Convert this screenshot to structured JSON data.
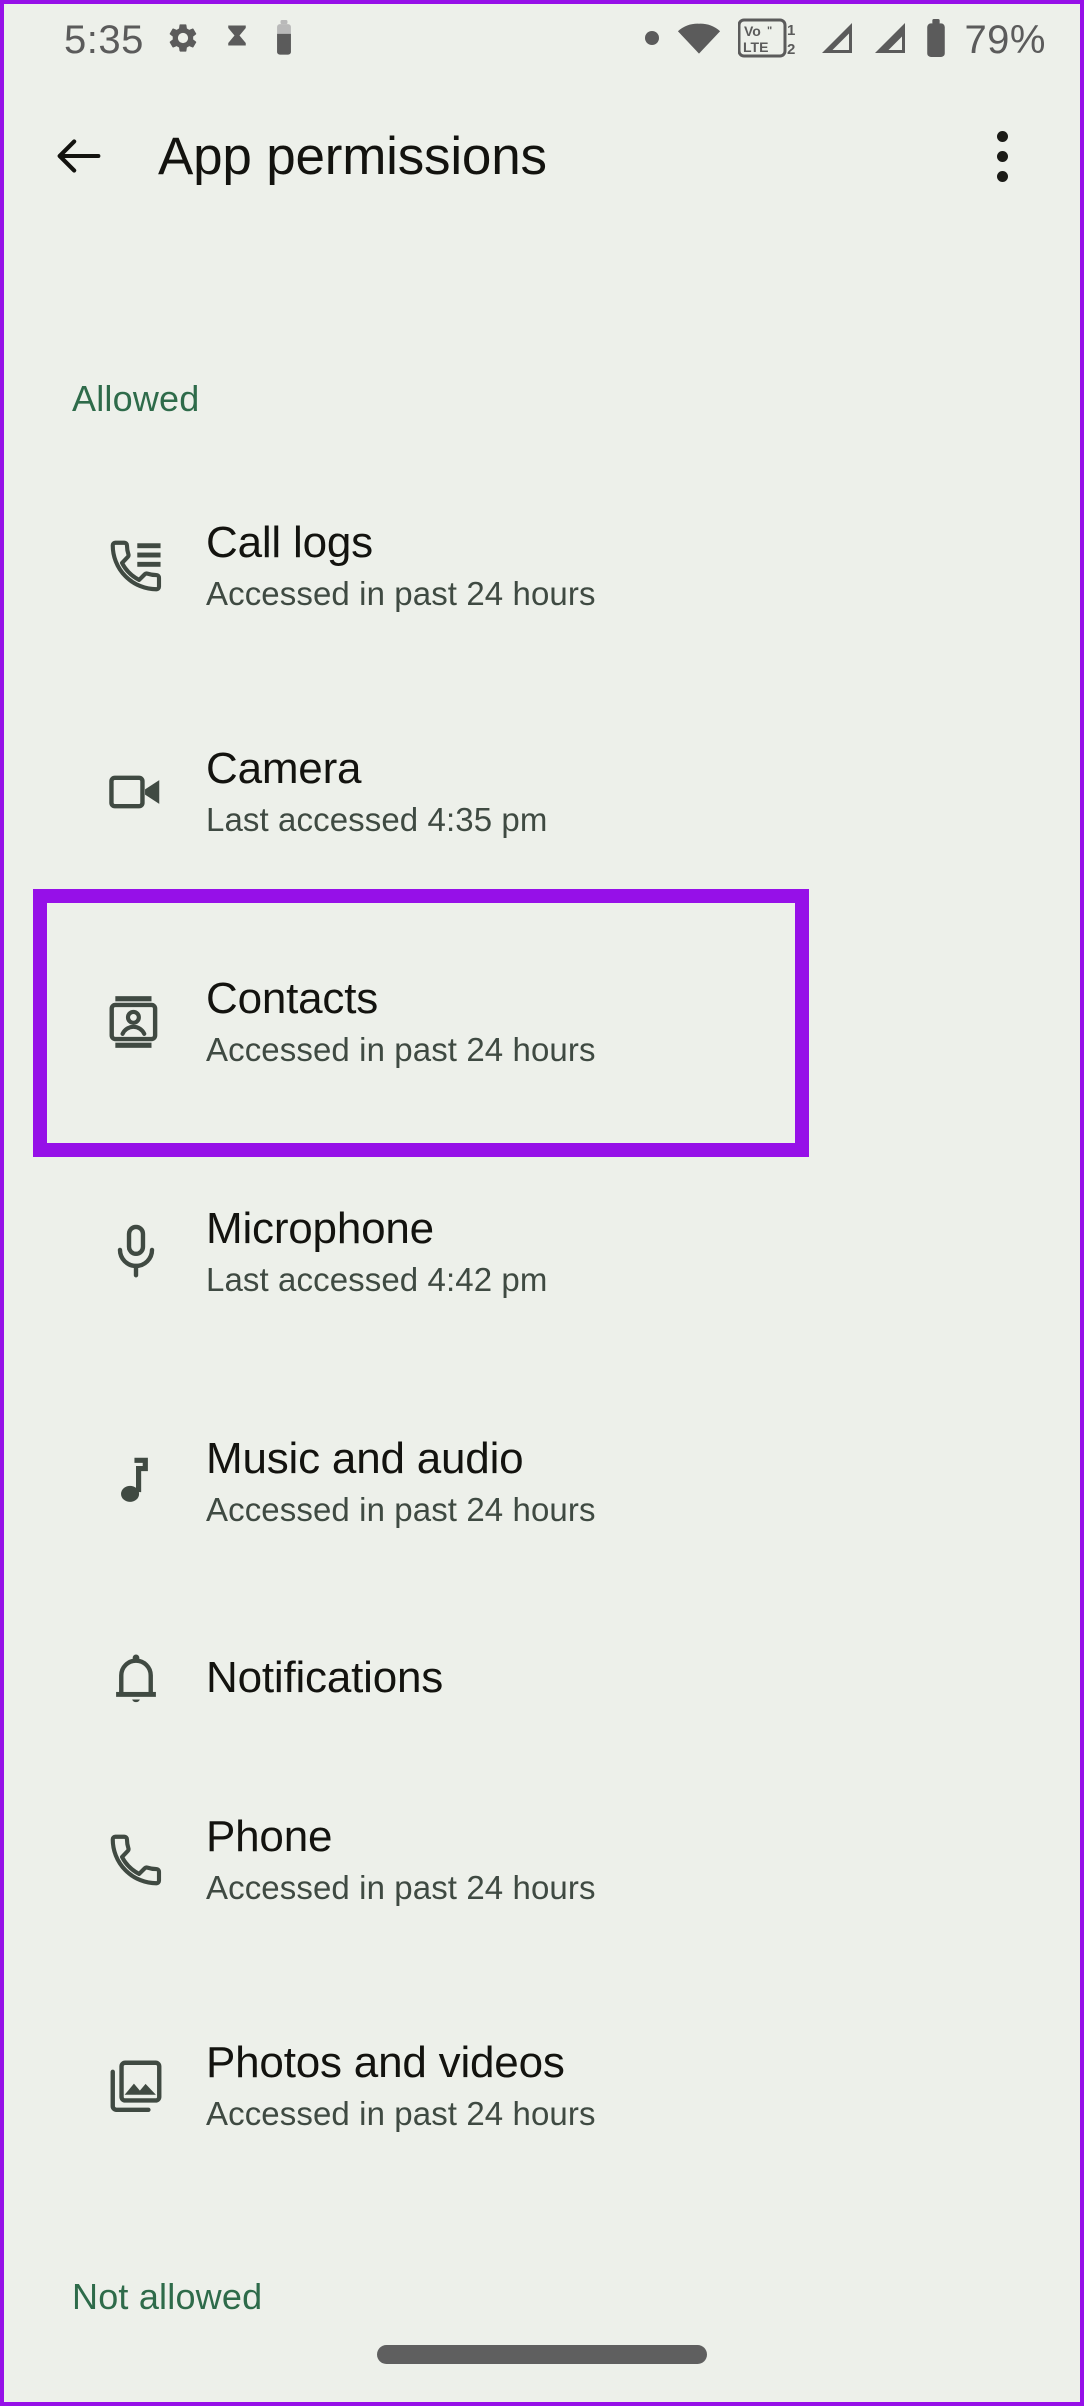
{
  "status_bar": {
    "time": "5:35",
    "battery_percent": "79%",
    "icons": [
      "gear-icon",
      "hourglass-icon",
      "battery-small-icon",
      "dot-icon",
      "wifi-icon",
      "volte-icon",
      "signal-1-icon",
      "signal-2-icon",
      "battery-icon"
    ],
    "volte_label_top": "Vo",
    "volte_label_bottom": "LTE",
    "sim1": "1",
    "sim2": "2"
  },
  "app_bar": {
    "back_label": "Back",
    "title": "App permissions",
    "overflow_label": "More options"
  },
  "sections": [
    {
      "label": "Allowed"
    },
    {
      "label": "Not allowed"
    }
  ],
  "permissions": [
    {
      "icon": "call-logs-icon",
      "title": "Call logs",
      "subtitle": "Accessed in past 24 hours"
    },
    {
      "icon": "camera-icon",
      "title": "Camera",
      "subtitle": "Last accessed 4:35 pm"
    },
    {
      "icon": "contacts-icon",
      "title": "Contacts",
      "subtitle": "Accessed in past 24 hours"
    },
    {
      "icon": "microphone-icon",
      "title": "Microphone",
      "subtitle": "Last accessed 4:42 pm"
    },
    {
      "icon": "music-icon",
      "title": "Music and audio",
      "subtitle": "Accessed in past 24 hours"
    },
    {
      "icon": "bell-icon",
      "title": "Notifications",
      "subtitle": ""
    },
    {
      "icon": "phone-icon",
      "title": "Phone",
      "subtitle": "Accessed in past 24 hours"
    },
    {
      "icon": "photos-icon",
      "title": "Photos and videos",
      "subtitle": "Accessed in past 24 hours"
    }
  ],
  "highlight": {
    "target": "Contacts",
    "color": "#9610e8"
  },
  "colors": {
    "background": "#edf0ea",
    "title_text": "#13130f",
    "subtitle_text": "#3f4a42",
    "section_green": "#2e6b4a",
    "icon": "#404a42",
    "status_icon": "#5b5b5b",
    "highlight_purple": "#9610e8",
    "nav_pill": "#5f5f5f"
  },
  "nav_bar": {
    "pill_label": "Home gesture bar"
  }
}
